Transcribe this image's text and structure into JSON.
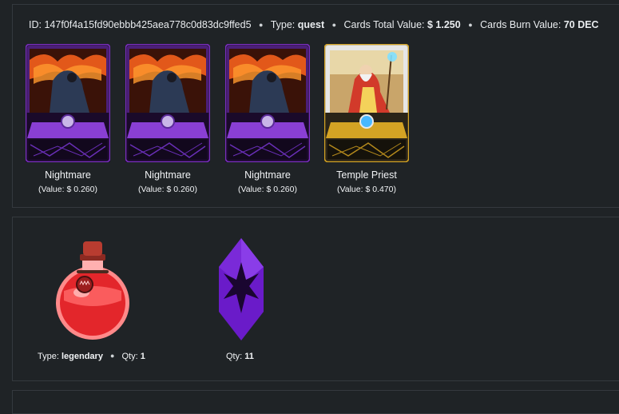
{
  "header": {
    "id_label": "ID:",
    "id_value": "147f0f4a15fd90ebbb425aea778c0d83dc9ffed5",
    "type_label": "Type:",
    "type_value": "quest",
    "total_label": "Cards Total Value:",
    "total_value": "$ 1.250",
    "burn_label": "Cards Burn Value:",
    "burn_value": "70 DEC"
  },
  "cards": [
    {
      "name": "Nightmare",
      "value": "(Value: $ 0.260)",
      "rarity": "epic",
      "frame_color": "#7a2fbf"
    },
    {
      "name": "Nightmare",
      "value": "(Value: $ 0.260)",
      "rarity": "epic",
      "frame_color": "#7a2fbf"
    },
    {
      "name": "Nightmare",
      "value": "(Value: $ 0.260)",
      "rarity": "epic",
      "frame_color": "#7a2fbf"
    },
    {
      "name": "Temple Priest",
      "value": "(Value: $ 0.470)",
      "rarity": "legendary",
      "frame_color": "#d4a324"
    }
  ],
  "items": [
    {
      "icon": "potion-icon",
      "type_label": "Type:",
      "type_value": "legendary",
      "qty_label": "Qty:",
      "qty_value": "1"
    },
    {
      "icon": "purple-crystal-icon",
      "qty_label": "Qty:",
      "qty_value": "11"
    }
  ],
  "colors": {
    "background": "#1f2326",
    "panel_border": "#34393e",
    "epic": "#7a2fbf",
    "legendary": "#d4a324",
    "potion_red": "#e3262b",
    "crystal_purple": "#6a1bc9"
  }
}
